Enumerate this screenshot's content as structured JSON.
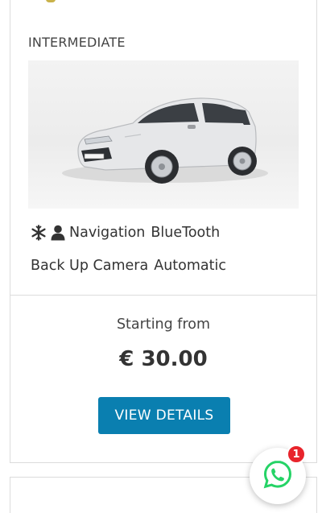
{
  "vehicle": {
    "category": "INTERMEDIATE",
    "image_icon": "car-photo-icon",
    "features_row1": {
      "icons": [
        "snowflake-icon",
        "person-icon"
      ],
      "items": [
        "Navigation",
        "BlueTooth"
      ]
    },
    "features_row2": {
      "items": [
        "Back Up Camera",
        "Automatic"
      ]
    },
    "pricing": {
      "starting_label": "Starting from",
      "price": "€ 30.00"
    },
    "details_button": "VIEW DETAILS"
  },
  "whatsapp": {
    "icon": "whatsapp-icon",
    "badge_count": "1"
  },
  "colors": {
    "button": "#0a7fb0",
    "badge": "#e8242c",
    "whatsapp": "#25d366"
  }
}
